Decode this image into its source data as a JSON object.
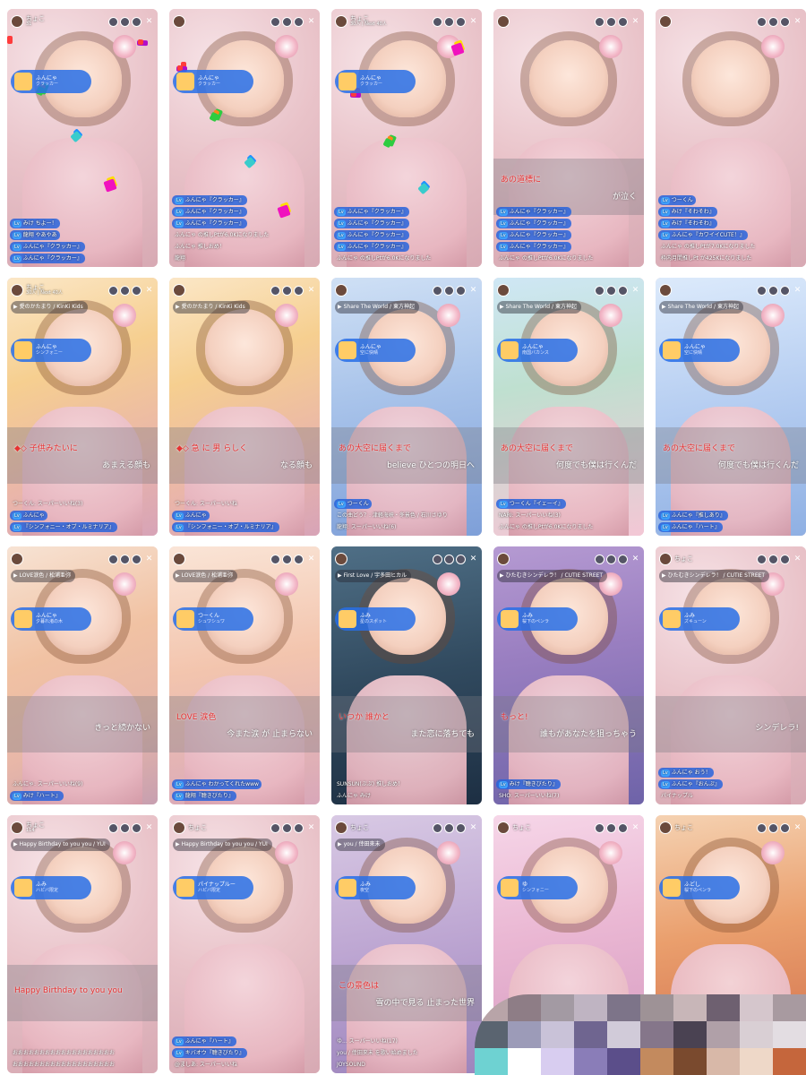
{
  "screens": [
    {
      "bg": "sakura",
      "host": "ちょこ",
      "sub": "31",
      "song": "",
      "gift": {
        "user": "ふんにゃ",
        "name": "クラッカー"
      },
      "lyric1": "",
      "lyric2": "",
      "chat": [
        {
          "t": "みけ ちよー！",
          "pill": true
        },
        {
          "t": "龍翔 やあやあ",
          "pill": true
        },
        {
          "t": "ふんにゃ『クラッカー』",
          "pill": true
        },
        {
          "t": "ふんにゃ『クラッカー』",
          "pill": true
        }
      ]
    },
    {
      "bg": "sakura",
      "host": "",
      "sub": "",
      "song": "",
      "gift": {
        "user": "ふんにゃ",
        "name": "クラッカー"
      },
      "lyric1": "",
      "lyric2": "",
      "chat": [
        {
          "t": "ふんにゃ『クラッカー』",
          "pill": true
        },
        {
          "t": "ふんにゃ『クラッカー』",
          "pill": true
        },
        {
          "t": "ふんにゃ『クラッカー』",
          "pill": true
        },
        {
          "t": "ふんにゃ の推しPtが6.0Kになりました",
          "pill": false
        },
        {
          "t": "ふんにゃ 推しおめ！",
          "pill": false
        },
        {
          "t": "龍翔",
          "pill": false
        }
      ]
    },
    {
      "bg": "sakura",
      "host": "ちょこ",
      "sub": "30人 | Next 40人",
      "song": "",
      "gift": {
        "user": "ふんにゃ",
        "name": "クラッカー"
      },
      "lyric1": "",
      "lyric2": "",
      "chat": [
        {
          "t": "ふんにゃ『クラッカー』",
          "pill": true
        },
        {
          "t": "ふんにゃ『クラッカー』",
          "pill": true
        },
        {
          "t": "ふんにゃ『クラッカー』",
          "pill": true
        },
        {
          "t": "ふんにゃ『クラッカー』",
          "pill": true
        },
        {
          "t": "ふんにゃ の推しPtが6.0Kになりました",
          "pill": false
        }
      ]
    },
    {
      "bg": "sakura",
      "host": "",
      "sub": "",
      "song": "",
      "gift": null,
      "lyric1": "あの道標に",
      "lyric2": "が泣く",
      "chat": [
        {
          "t": "ふんにゃ『クラッカー』",
          "pill": true
        },
        {
          "t": "ふんにゃ『クラッカー』",
          "pill": true
        },
        {
          "t": "ふんにゃ『クラッカー』",
          "pill": true
        },
        {
          "t": "ふんにゃ『クラッカー』",
          "pill": true
        },
        {
          "t": "ふんにゃ の推しPtが6.0Kになりました",
          "pill": false
        }
      ]
    },
    {
      "bg": "sakura",
      "host": "",
      "sub": "",
      "song": "",
      "gift": null,
      "lyric1": "",
      "lyric2": "",
      "chat": [
        {
          "t": "つーくん",
          "pill": true
        },
        {
          "t": "みけ『そわそわ』",
          "pill": true
        },
        {
          "t": "みけ『そわそわ』",
          "pill": true
        },
        {
          "t": "ふんにゃ『カワイイCUTE！』",
          "pill": true
        },
        {
          "t": "ふんにゃ の推しPtが7.0Kになりました",
          "pill": false
        },
        {
          "t": "枠内月間推しPt が425Kになりました",
          "pill": false
        }
      ]
    },
    {
      "bg": "golden",
      "host": "ちょこ",
      "sub": "30人 | Next 40人",
      "song": "愛のかたまり / KinKi Kids",
      "gift": {
        "user": "ふんにゃ",
        "name": "シンフォニー"
      },
      "lyric1": "◆◇ 子供みたいに",
      "lyric2": "あまえる顔も",
      "chat": [
        {
          "t": "つーくん: スーパーいいね(3)",
          "pill": false
        },
        {
          "t": "ふんにゃ",
          "pill": true
        },
        {
          "t": "『シンフォニー・オブ・ルミナリア』",
          "pill": true
        }
      ]
    },
    {
      "bg": "golden",
      "host": "",
      "sub": "",
      "song": "愛のかたまり / KinKi Kids",
      "gift": null,
      "lyric1": "◆◇ 急 に 男 らしく",
      "lyric2": "なる顔も",
      "chat": [
        {
          "t": "つーくん: スーパーいいね",
          "pill": false
        },
        {
          "t": "ふんにゃ",
          "pill": true
        },
        {
          "t": "『シンフォニー・オブ・ルミナリア』",
          "pill": true
        }
      ]
    },
    {
      "bg": "blue",
      "host": "",
      "sub": "",
      "song": "Share The World / 東方神起",
      "gift": {
        "user": "ふんにゃ",
        "name": "空に快晴"
      },
      "lyric1": "あの大空に届くまで",
      "lyric2": "believe ひとつの明日へ",
      "chat": [
        {
          "t": "つーくん",
          "pill": true
        },
        {
          "t": "この曲どう？: 津軽海峡・冬景色 / 石川さゆり",
          "pill": false
        },
        {
          "t": "龍翔: スーパーいいね(6)",
          "pill": false
        }
      ]
    },
    {
      "bg": "tropical",
      "host": "",
      "sub": "",
      "song": "Share The World / 東方神起",
      "gift": {
        "user": "ふんにゃ",
        "name": "南国バカンス"
      },
      "lyric1": "あの大空に届くまで",
      "lyric2": "何度でも僕は行くんだ",
      "chat": [
        {
          "t": "つーくん『イェーイ』",
          "pill": true
        },
        {
          "t": "NARI: スーパーいいね(3)",
          "pill": false
        },
        {
          "t": "ふんにゃ の推しPtが6.0Kになりました",
          "pill": false
        }
      ]
    },
    {
      "bg": "sky",
      "host": "",
      "sub": "",
      "song": "Share The World / 東方神起",
      "gift": {
        "user": "ふんにゃ",
        "name": "空に快晴"
      },
      "lyric1": "あの大空に届くまで",
      "lyric2": "何度でも僕は行くんだ",
      "chat": [
        {
          "t": "ふんにゃ『推しあり』",
          "pill": true
        },
        {
          "t": "ふんにゃ『ハート』",
          "pill": true
        }
      ]
    },
    {
      "bg": "sunset",
      "host": "",
      "sub": "",
      "song": "LOVE涙色 / 松浦亜弥",
      "gift": {
        "user": "ふんにゃ",
        "name": "夕暮れ渚の木"
      },
      "lyric1": "",
      "lyric2": "きっと続かない",
      "chat": [
        {
          "t": "ふんにゃ: スーパーいいね(9)",
          "pill": false
        },
        {
          "t": "みけ『ハート』",
          "pill": true
        }
      ]
    },
    {
      "bg": "warmsky",
      "host": "",
      "sub": "",
      "song": "LOVE涙色 / 松浦亜弥",
      "gift": {
        "user": "つーくん",
        "name": "シュワシュワ"
      },
      "lyric1": "LOVE 涙色",
      "lyric2": "今また涙 が 止まらない",
      "chat": [
        {
          "t": "ふんにゃ わかってくれたwww",
          "pill": true
        },
        {
          "t": "龍翔『聴きびたり』",
          "pill": true
        }
      ]
    },
    {
      "bg": "night",
      "host": "",
      "sub": "",
      "song": "First Love / 宇多田ヒカル",
      "gift": {
        "user": "ふみ",
        "name": "星のスポット"
      },
      "lyric1": "いつか 誰かと",
      "lyric2": "また恋に落ちても",
      "chat": [
        {
          "t": "SUNSUN(ぶぶ) 推しおめ！",
          "pill": false
        },
        {
          "t": "ふんにゃ みけ",
          "pill": false
        }
      ]
    },
    {
      "bg": "neon",
      "host": "",
      "sub": "",
      "song": "ひたむきシンデレラ！ / CUTIE STREET",
      "gift": {
        "user": "ふみ",
        "name": "桜下のペンラ"
      },
      "lyric1": "もっと!",
      "lyric2": "誰もがあなたを狙っちゃう",
      "chat": [
        {
          "t": "みけ『聴きびたり』",
          "pill": true
        },
        {
          "t": "SHO: スーパーいいね(7)",
          "pill": false
        }
      ]
    },
    {
      "bg": "sakura",
      "host": "ちょこ",
      "sub": "",
      "song": "ひたむきシンデレラ！ / CUTIE STREET",
      "gift": {
        "user": "ふみ",
        "name": "ズキューン"
      },
      "lyric1": "",
      "lyric2": "シンデレラ!",
      "chat": [
        {
          "t": "ふんにゃ おう！",
          "pill": true
        },
        {
          "t": "ふんにゃ『おんぷ』",
          "pill": true
        },
        {
          "t": "パイナップル",
          "pill": false
        }
      ]
    },
    {
      "bg": "sakura",
      "host": "ちょこ",
      "sub": "114",
      "song": "Happy Birthday to you you / YUI",
      "gift": {
        "user": "ふみ",
        "name": "ハピバ限定"
      },
      "lyric1": "Happy Birthday to you you",
      "lyric2": "",
      "chat": [
        {
          "t": "おおおおおおおおおおおおおおおおおおお",
          "pill": false
        },
        {
          "t": "おおおおおおおおおおおおおおおおおおお",
          "pill": false
        }
      ]
    },
    {
      "bg": "sakura",
      "host": "ちょこ",
      "sub": "",
      "song": "Happy Birthday to you you / YUI",
      "gift": {
        "user": "パイナップルー",
        "name": "ハピバ限定"
      },
      "lyric1": "",
      "lyric2": "",
      "chat": [
        {
          "t": "ふんにゃ『ハート』",
          "pill": true
        },
        {
          "t": "キバオウ『聴きびたり』",
          "pill": true
        },
        {
          "t": "@ましあ: スーパーいいね",
          "pill": false
        }
      ]
    },
    {
      "bg": "purple",
      "host": "ちょこ",
      "sub": "",
      "song": "you / 倖田來未",
      "gift": {
        "user": "ふみ",
        "name": "夜空"
      },
      "lyric1": "この景色は",
      "lyric2": "雪の中で見る 止まった世界",
      "chat": [
        {
          "t": "ゆ... スーパーいいね(17)",
          "pill": false
        },
        {
          "t": "you / 倖田來未 を歌い始めました",
          "pill": false
        },
        {
          "t": "JOYSOUND",
          "pill": false
        }
      ]
    },
    {
      "bg": "pinkglow",
      "host": "ちょこ",
      "sub": "",
      "song": "",
      "gift": {
        "user": "ゆ",
        "name": "シンフォニー"
      },
      "lyric1": "",
      "lyric2": "",
      "chat": []
    },
    {
      "bg": "fire",
      "host": "ちょこ",
      "sub": "",
      "song": "",
      "gift": {
        "user": "ふどし",
        "name": "桜下のペンラ"
      },
      "lyric1": "",
      "lyric2": "",
      "chat": []
    }
  ],
  "swatches": [
    "#b8a4a8",
    "#8e7d86",
    "#a39aa3",
    "#bfb4c2",
    "#7d7489",
    "#9e9296",
    "#c8b6b8",
    "#6e6070",
    "#d5c6cc",
    "#a89aa0",
    "#5a6470",
    "#9c9bb8",
    "#c9c2d8",
    "#6f6590",
    "#d1cbd9",
    "#85768a",
    "#4a4252",
    "#b0a0a8",
    "#d9cfd4",
    "#e3dde2",
    "#6ed2d2",
    "#ffffff",
    "#d8cdf0",
    "#8a7db8",
    "#5b4e8a",
    "#c38a5e",
    "#7a4a2e",
    "#d8b8a8",
    "#eed8c8",
    "#c5663c"
  ],
  "colors": {
    "accent": "#2f74e0",
    "lyric_red": "#e63232",
    "lv": "#3fa2ff"
  }
}
